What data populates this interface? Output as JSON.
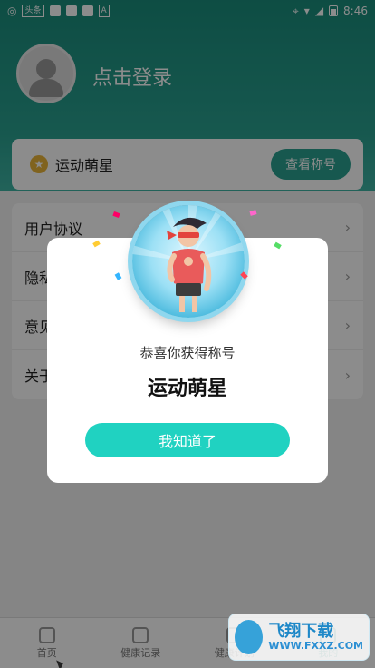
{
  "status_bar": {
    "time": "8:46",
    "toutiao_label": "头条",
    "a_label": "A"
  },
  "profile": {
    "login_label": "点击登录"
  },
  "title_card": {
    "title": "运动萌星",
    "button": "查看称号"
  },
  "menu": {
    "items": [
      {
        "label": "用户协议"
      },
      {
        "label": "隐私政策"
      },
      {
        "label": "意见反馈"
      },
      {
        "label": "关于我们"
      }
    ]
  },
  "tabs": [
    {
      "label": "首页"
    },
    {
      "label": "健康记录"
    },
    {
      "label": "健康计划"
    },
    {
      "label": "我的"
    }
  ],
  "dialog": {
    "subtitle": "恭喜你获得称号",
    "title": "运动萌星",
    "button": "我知道了"
  },
  "watermark": {
    "main": "飞翔下载",
    "url": "WWW.FXXZ.COM"
  },
  "colors": {
    "primary": "#2aa190",
    "dialog_button": "#20d2c1"
  }
}
